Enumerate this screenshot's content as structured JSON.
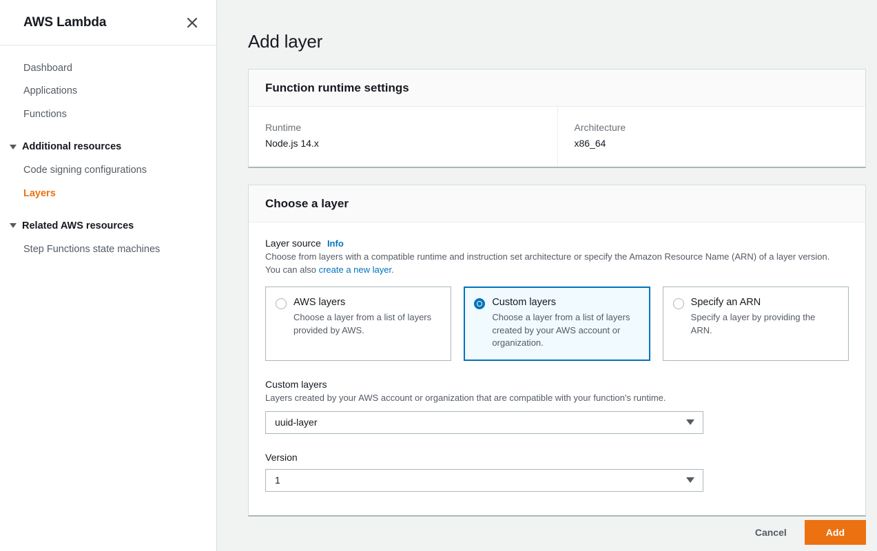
{
  "sidebar": {
    "title": "AWS Lambda",
    "close_icon": "close-icon",
    "items": [
      {
        "label": "Dashboard",
        "type": "link",
        "active": false
      },
      {
        "label": "Applications",
        "type": "link",
        "active": false
      },
      {
        "label": "Functions",
        "type": "link",
        "active": false
      }
    ],
    "groups": [
      {
        "label": "Additional resources",
        "caret_icon": "caret-down-icon",
        "items": [
          {
            "label": "Code signing configurations",
            "active": false
          },
          {
            "label": "Layers",
            "active": true
          }
        ]
      },
      {
        "label": "Related AWS resources",
        "caret_icon": "caret-down-icon",
        "items": [
          {
            "label": "Step Functions state machines",
            "active": false
          }
        ]
      }
    ],
    "active_color": "#ec7211"
  },
  "main": {
    "page_title": "Add layer",
    "runtime_panel": {
      "header": "Function runtime settings",
      "fields": [
        {
          "label": "Runtime",
          "value": "Node.js 14.x"
        },
        {
          "label": "Architecture",
          "value": "x86_64"
        }
      ]
    },
    "choose_panel": {
      "header": "Choose a layer",
      "layer_source": {
        "label": "Layer source",
        "info_label": "Info",
        "description_part1": "Choose from layers with a compatible runtime and instruction set architecture or specify the Amazon Resource Name (ARN) of a layer version. You can also ",
        "description_link": "create a new layer",
        "description_part2": ".",
        "options": [
          {
            "title": "AWS layers",
            "description": "Choose a layer from a list of layers provided by AWS.",
            "selected": false
          },
          {
            "title": "Custom layers",
            "description": "Choose a layer from a list of layers created by your AWS account or organization.",
            "selected": true
          },
          {
            "title": "Specify an ARN",
            "description": "Specify a layer by providing the ARN.",
            "selected": false
          }
        ]
      },
      "custom_layers": {
        "label": "Custom layers",
        "description": "Layers created by your AWS account or organization that are compatible with your function's runtime.",
        "selected_value": "uuid-layer",
        "caret_icon": "chevron-down-icon"
      },
      "version": {
        "label": "Version",
        "selected_value": "1",
        "caret_icon": "chevron-down-icon"
      }
    },
    "footer": {
      "cancel_label": "Cancel",
      "add_label": "Add",
      "add_color": "#ec7211"
    }
  }
}
